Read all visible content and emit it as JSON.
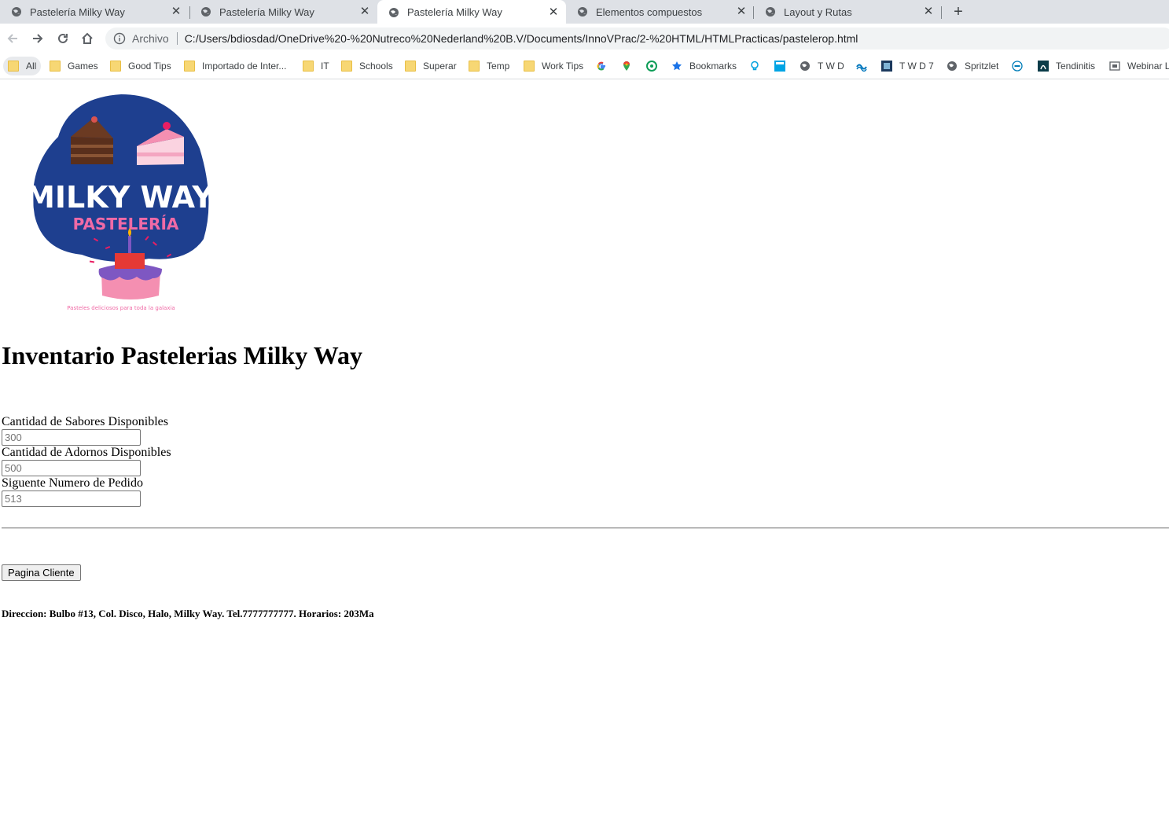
{
  "browser": {
    "tabs": [
      {
        "title": "Pastelería Milky Way",
        "active": false
      },
      {
        "title": "Pastelería Milky Way",
        "active": false
      },
      {
        "title": "Pastelería Milky Way",
        "active": true
      },
      {
        "title": "Elementos compuestos",
        "active": false
      },
      {
        "title": "Layout y Rutas",
        "active": false
      }
    ],
    "new_tab_icon": "plus-icon",
    "omnibox": {
      "scheme_label": "Archivo",
      "url": "C:/Users/bdiosdad/OneDrive%20-%20Nutreco%20Nederland%20B.V/Documents/InnoVPrac/2-%20HTML/HTMLPracticas/pastelerop.html"
    },
    "bookmarks": [
      {
        "label": "All",
        "icon": "folder-icon"
      },
      {
        "label": "Games",
        "icon": "folder-icon"
      },
      {
        "label": "Good Tips",
        "icon": "folder-icon"
      },
      {
        "label": "Importado de Inter...",
        "icon": "folder-icon"
      },
      {
        "label": "IT",
        "icon": "folder-icon"
      },
      {
        "label": "Schools",
        "icon": "folder-icon"
      },
      {
        "label": "Superar",
        "icon": "folder-icon"
      },
      {
        "label": "Temp",
        "icon": "folder-icon"
      },
      {
        "label": "Work Tips",
        "icon": "folder-icon"
      },
      {
        "label": "",
        "icon": "google-icon"
      },
      {
        "label": "",
        "icon": "maps-icon"
      },
      {
        "label": "",
        "icon": "green-circle-icon"
      },
      {
        "label": "Bookmarks",
        "icon": "star-icon"
      },
      {
        "label": "",
        "icon": "lightbulb-icon"
      },
      {
        "label": "",
        "icon": "blue-square-icon"
      },
      {
        "label": "T W D",
        "icon": "globe-icon"
      },
      {
        "label": "",
        "icon": "wave-icon"
      },
      {
        "label": "T W D 7",
        "icon": "site-icon"
      },
      {
        "label": "Spritzlet",
        "icon": "globe-icon"
      },
      {
        "label": "",
        "icon": "dell-icon"
      },
      {
        "label": "Tendinitis",
        "icon": "site-icon"
      },
      {
        "label": "Webinar L",
        "icon": "webinar-icon"
      }
    ]
  },
  "page": {
    "logo": {
      "brand": "MILKY WAY",
      "sub": "PASTELERÍA",
      "tagline": "Pasteles deliciosos para toda la galaxia"
    },
    "heading": "Inventario Pastelerias Milky Way",
    "fields": [
      {
        "label": "Cantidad de Sabores Disponibles",
        "placeholder": "300"
      },
      {
        "label": "Cantidad de Adornos Disponibles",
        "placeholder": "500"
      },
      {
        "label": "Siguente Numero de Pedido",
        "placeholder": "513"
      }
    ],
    "button_label": "Pagina Cliente",
    "footer": "Direccion: Bulbo #13, Col. Disco, Halo, Milky Way. Tel.7777777777. Horarios: 203Ma"
  },
  "colors": {
    "tabstrip": "#dee1e6",
    "logo_blue": "#1e3f8f",
    "logo_pink": "#f06aa6"
  }
}
